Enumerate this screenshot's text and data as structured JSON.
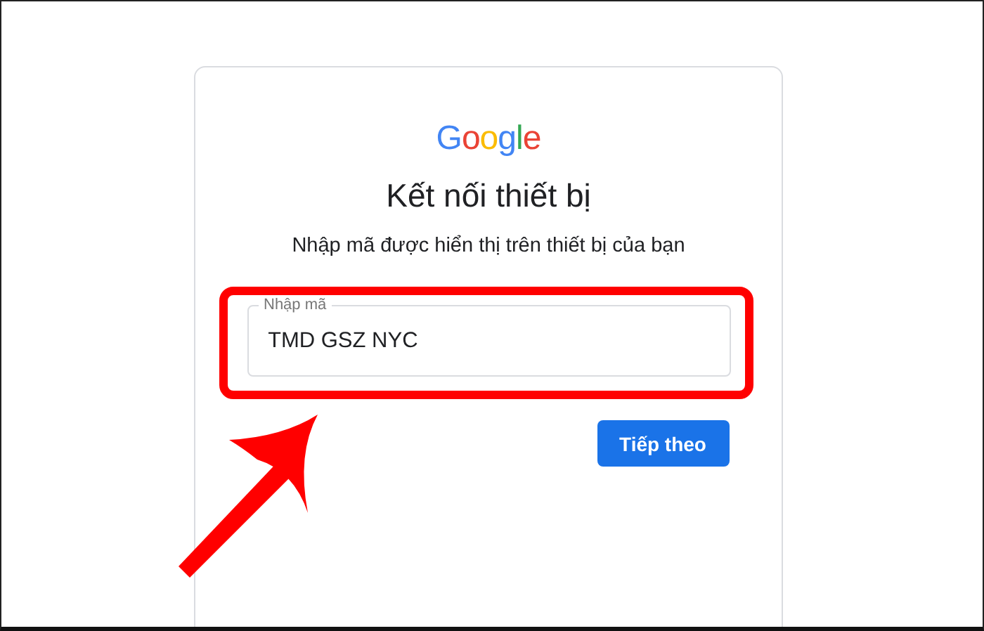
{
  "logo": "Google",
  "title": "Kết nối thiết bị",
  "subtitle": "Nhập mã được hiển thị trên thiết bị của bạn",
  "code_field": {
    "label": "Nhập mã",
    "value": "TMD GSZ NYC"
  },
  "next_button": "Tiếp theo"
}
